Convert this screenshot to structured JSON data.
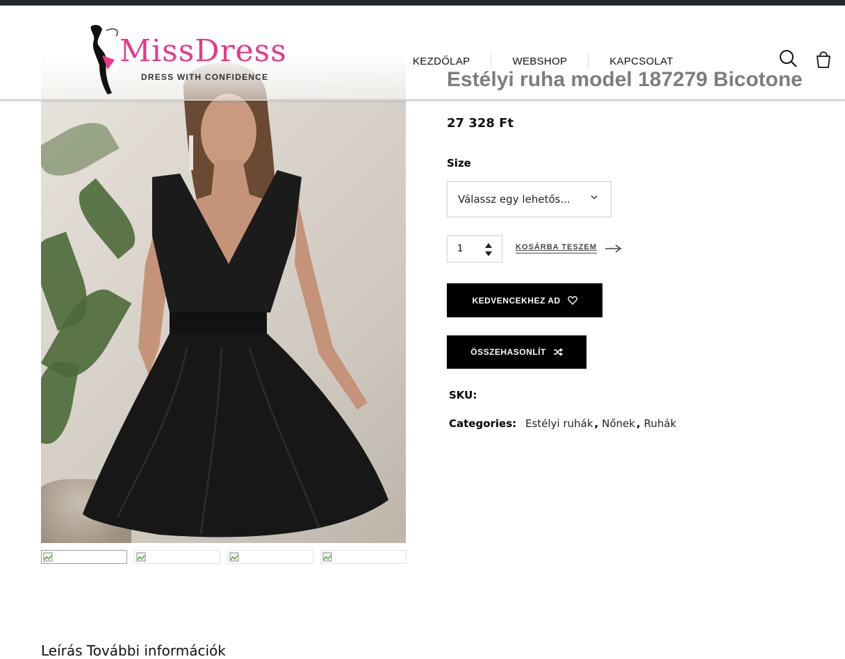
{
  "header": {
    "logo_text": "MissDress",
    "logo_tagline": "DRESS WITH CONFIDENCE",
    "nav": [
      "KEZDŐLAP",
      "WEBSHOP",
      "KAPCSOLAT"
    ],
    "icons": {
      "search": "search-icon",
      "cart": "shopping-bag-icon"
    }
  },
  "product": {
    "title": "Estélyi ruha model 187279 Bicotone",
    "price": "27 328 Ft",
    "size_label": "Size",
    "size_placeholder": "Válassz egy lehetős...",
    "quantity": "1",
    "add_to_cart": "KOSÁRBA TESZEM",
    "wishlist_button": "KEDVENCEKHEZ AD",
    "compare_button": "ÖSSZEHASONLÍT",
    "sku_label": "SKU:",
    "categories_label": "Categories:",
    "categories": [
      "Estélyi ruhák",
      "Nőnek",
      "Ruhák"
    ]
  },
  "footer_partial": "Leírás    További információk",
  "colors": {
    "brand_pink": "#e8388a",
    "button_bg": "#000000",
    "topbar": "#25282b"
  }
}
